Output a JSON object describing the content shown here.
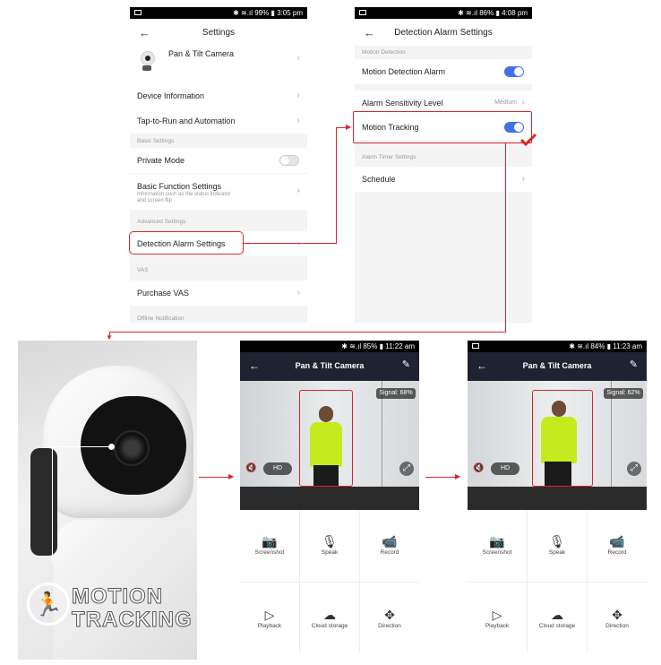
{
  "status1": {
    "icons": "✱ ≋.ıl",
    "battery": "99%",
    "time": "3:05 pm"
  },
  "status2": {
    "icons": "✱ ≋.ıl",
    "battery": "86%",
    "time": "4:08 pm"
  },
  "status3": {
    "icons": "✱ ≋.ıl",
    "battery": "85%",
    "time": "11:22 am"
  },
  "status4": {
    "icons": "✱ ≋.ıl",
    "battery": "84%",
    "time": "11:23 am"
  },
  "settings": {
    "title": "Settings",
    "device_name": "Pan & Tilt Camera",
    "items": {
      "device_info": "Device Information",
      "tap_to_run": "Tap-to-Run and Automation",
      "basic_settings_header": "Basic Settings",
      "private_mode": "Private Mode",
      "basic_function": "Basic Function Settings",
      "basic_function_sub1": "Information such as the status indicator",
      "basic_function_sub2": "and screen flip",
      "advanced_header": "Advanced Settings",
      "detection_alarm": "Detection Alarm Settings",
      "vas_header": "VAS",
      "purchase_vas": "Purchase VAS",
      "offline_header": "Offline Notification"
    }
  },
  "detection": {
    "title": "Detection Alarm Settings",
    "motion_header": "Motion Detection",
    "motion_alarm": "Motion Detection Alarm",
    "sensitivity": "Alarm Sensitivity Level",
    "sensitivity_value": "Medium",
    "motion_tracking": "Motion Tracking",
    "timer_header": "Alarm Timer Settings",
    "schedule": "Schedule"
  },
  "camera_view": {
    "title": "Pan & Tilt Camera",
    "hd": "HD",
    "signal1": "Signal: 68%",
    "signal2": "Signal: 62%",
    "controls": {
      "screenshot": "Screenshot",
      "speak": "Speak",
      "record": "Record",
      "playback": "Playback",
      "cloud": "Cloud storage",
      "direction": "Direction"
    }
  },
  "logo": {
    "line1": "MOTION",
    "line2": "TRACKING"
  },
  "colors": {
    "accent": "#3e73e8",
    "highlight": "#d9262c",
    "header_bg": "#1f2230"
  }
}
